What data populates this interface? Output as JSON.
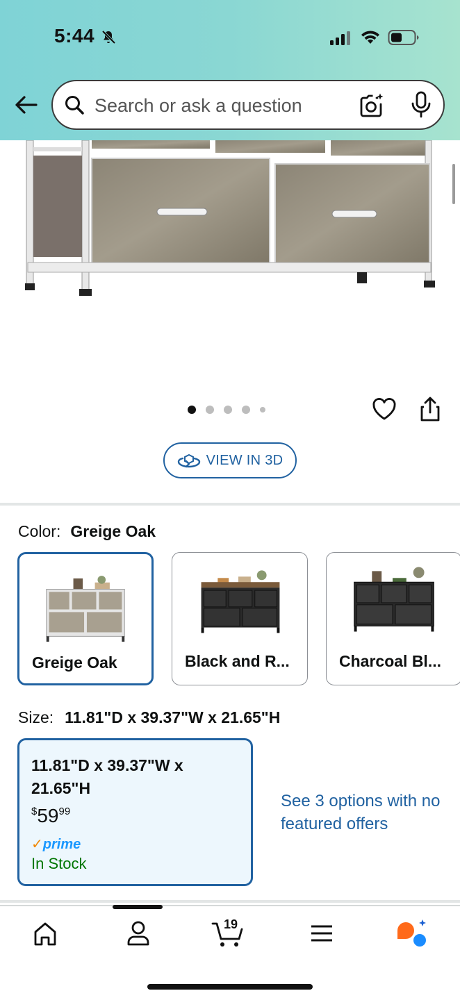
{
  "status_bar": {
    "time": "5:44"
  },
  "search": {
    "placeholder": "Search or ask a question"
  },
  "gallery": {
    "image_count": 5,
    "active_index": 0,
    "view_3d_label": "VIEW IN 3D"
  },
  "color": {
    "label": "Color:",
    "selected_value": "Greige Oak",
    "options": [
      {
        "label": "Greige Oak",
        "selected": true
      },
      {
        "label": "Black and R...",
        "selected": false
      },
      {
        "label": "Charcoal Bl...",
        "selected": false
      }
    ]
  },
  "size": {
    "label": "Size:",
    "selected_value": "11.81\"D x 39.37\"W x 21.65\"H",
    "card": {
      "title": "11.81\"D x 39.37\"W x 21.65\"H",
      "price_symbol": "$",
      "price_whole": "59",
      "price_fraction": "99",
      "prime_label": "prime",
      "availability": "In Stock"
    },
    "other_options_link": "See 3 options with no featured offers"
  },
  "bottom_nav": {
    "items": [
      "home-icon",
      "account-icon",
      "cart-icon",
      "menu-icon",
      "rufus-assistant-icon"
    ],
    "cart_count": "19"
  },
  "colors": {
    "header_gradient_start": "#7fd3d6",
    "header_gradient_end": "#a7e3cf",
    "accent_blue": "#2162a1",
    "in_stock_green": "#007600",
    "prime_blue": "#1a98ff",
    "selected_card_bg": "#edf7fd"
  }
}
